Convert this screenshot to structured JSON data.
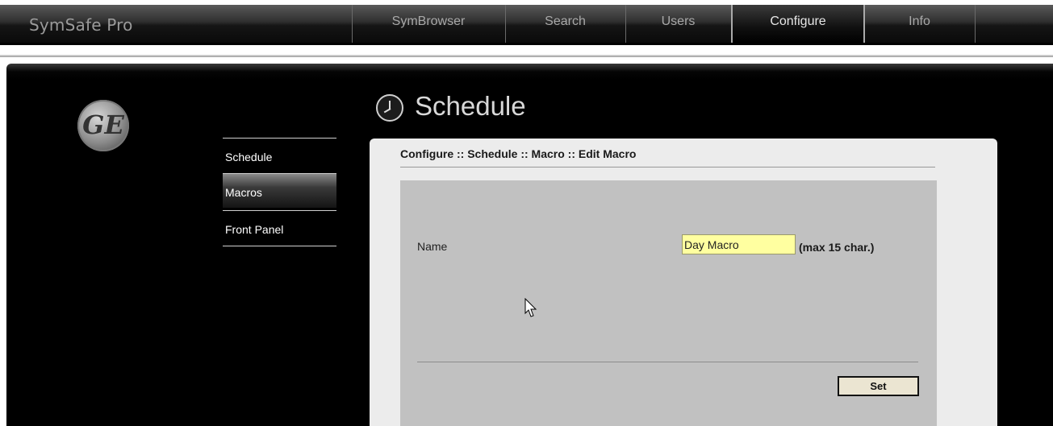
{
  "app_title": "SymSafe Pro",
  "nav": {
    "tabs": [
      {
        "label": "SymBrowser",
        "active": false
      },
      {
        "label": "Search",
        "active": false
      },
      {
        "label": "Users",
        "active": false
      },
      {
        "label": "Configure",
        "active": true
      },
      {
        "label": "Info",
        "active": false
      }
    ]
  },
  "logo": {
    "text": "GE",
    "icon": "ge-logo"
  },
  "sidebar": {
    "items": [
      {
        "label": "Schedule",
        "active": false
      },
      {
        "label": "Macros",
        "active": true
      },
      {
        "label": "Front Panel",
        "active": false
      }
    ]
  },
  "page": {
    "title": "Schedule",
    "icon": "clock-icon",
    "breadcrumb": "Configure :: Schedule :: Macro :: Edit Macro"
  },
  "form": {
    "name_label": "Name",
    "name_value": "Day Macro",
    "max_hint": "(max 15 char.)",
    "set_label": "Set"
  },
  "colors": {
    "input_bg": "#ffffa0",
    "panel_bg": "#c1c1c1",
    "content_bg": "#ececec",
    "button_bg": "#ebe5d2"
  }
}
